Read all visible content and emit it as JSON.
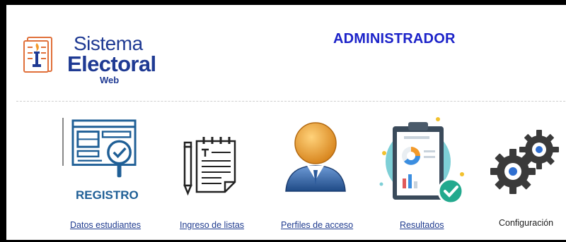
{
  "logo": {
    "line1": "Sistema",
    "line2": "Electoral",
    "line3": "Web"
  },
  "header": {
    "title": "ADMINISTRADOR"
  },
  "menu": [
    {
      "label": "Datos estudiantes",
      "icon": "registration-form-icon",
      "icon_caption": "REGISTRO"
    },
    {
      "label": "Ingreso de listas",
      "icon": "notepad-pencil-icon"
    },
    {
      "label": "Perfiles de acceso",
      "icon": "user-profile-icon"
    },
    {
      "label": "Resultados",
      "icon": "results-clipboard-icon"
    },
    {
      "label": "Configuración",
      "icon": "gears-icon"
    }
  ],
  "colors": {
    "brand_blue": "#1f3a93",
    "title_blue": "#1c23c9",
    "registro_blue": "#1f5f96",
    "avatar_orange": "#e8a33a",
    "avatar_blue": "#2f5f9e",
    "check_teal": "#23a98e",
    "gear_dark": "#3a3a3a",
    "gear_dot": "#2f6fd0"
  }
}
